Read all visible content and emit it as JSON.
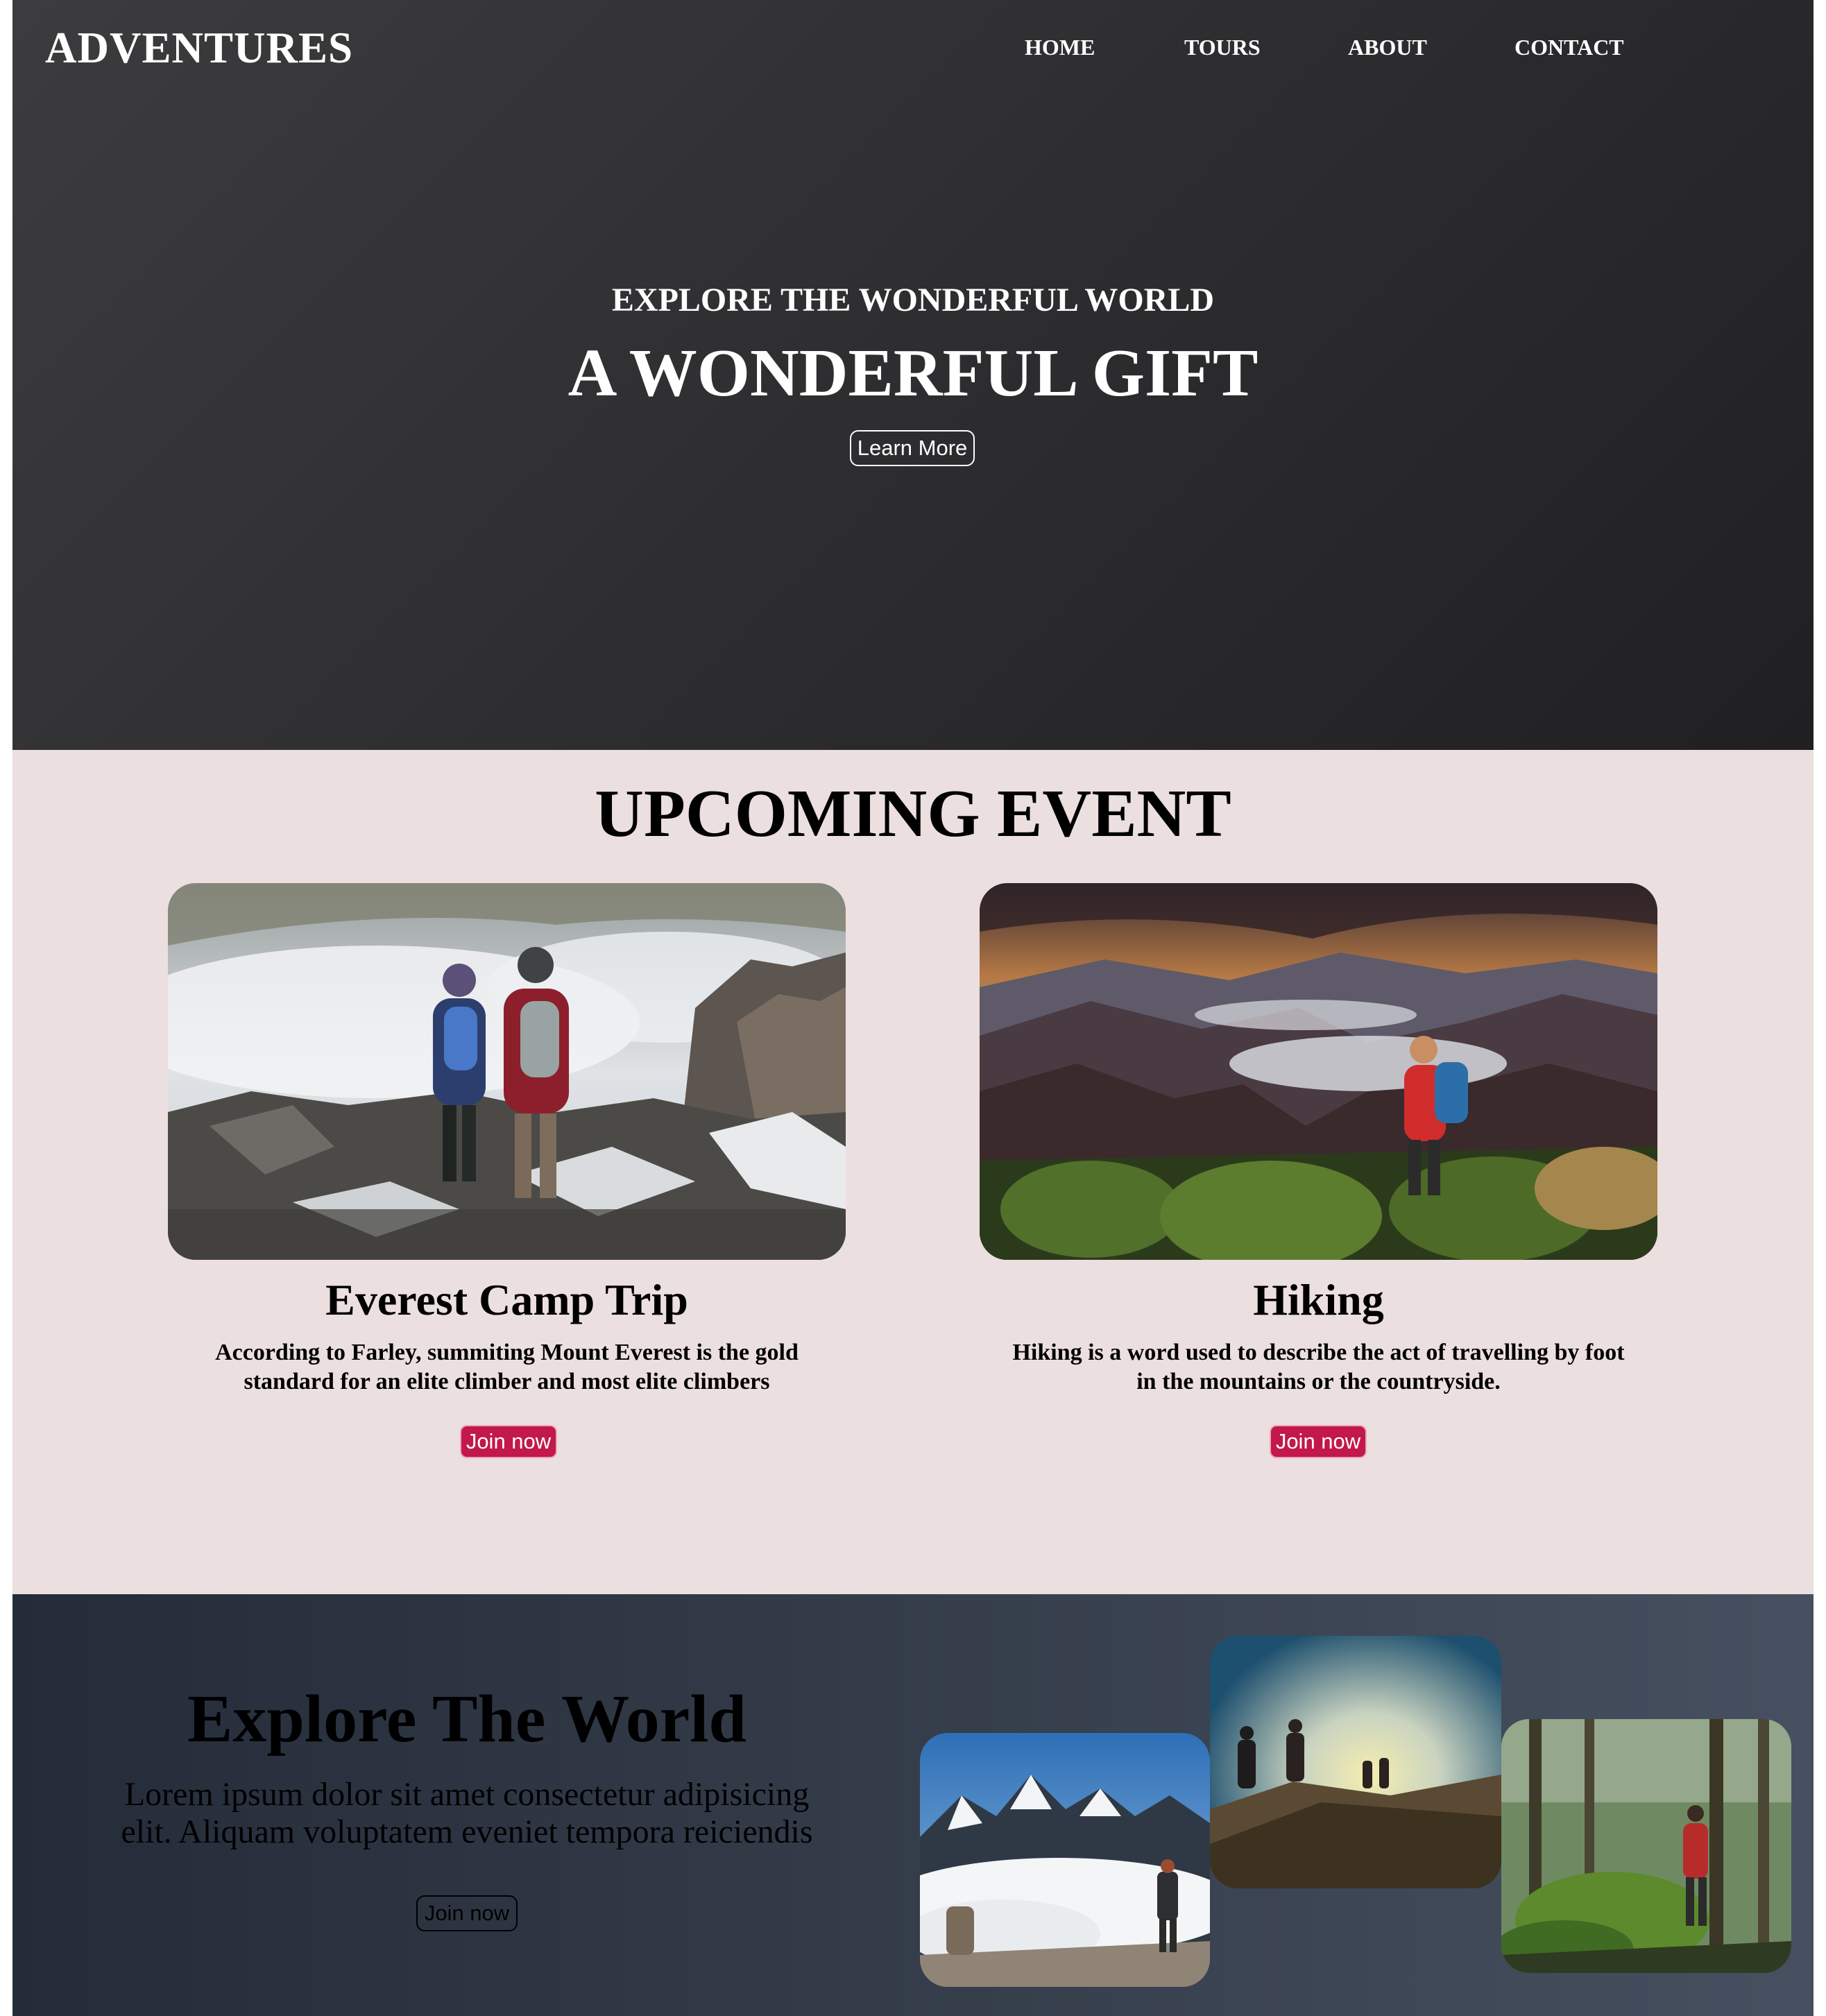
{
  "header": {
    "logo": "ADVENTURES",
    "nav": [
      "HOME",
      "TOURS",
      "ABOUT",
      "CONTACT"
    ]
  },
  "hero": {
    "subtitle": "EXPLORE THE WONDERFUL WORLD",
    "title": "A WONDERFUL GIFT",
    "button": "Learn More"
  },
  "events": {
    "title": "UPCOMING EVENT",
    "cards": [
      {
        "title": "Everest Camp Trip",
        "text": "According to Farley, summiting Mount Everest is the gold standard for an elite climber and most elite climbers",
        "button": "Join now"
      },
      {
        "title": "Hiking",
        "text": "Hiking is a word used to describe the act of travelling by foot in the mountains or the countryside.",
        "button": "Join now"
      }
    ]
  },
  "explore": {
    "title": "Explore The World",
    "text": "Lorem ipsum dolor sit amet consectetur adipisicing elit. Aliquam voluptatem eveniet tempora reiciendis",
    "button": "Join now"
  },
  "colors": {
    "hero_bg": "#2f2f31",
    "events_bg": "#ecdfdf",
    "join_button": "#c2184b",
    "explore_bg": "#333b48"
  }
}
